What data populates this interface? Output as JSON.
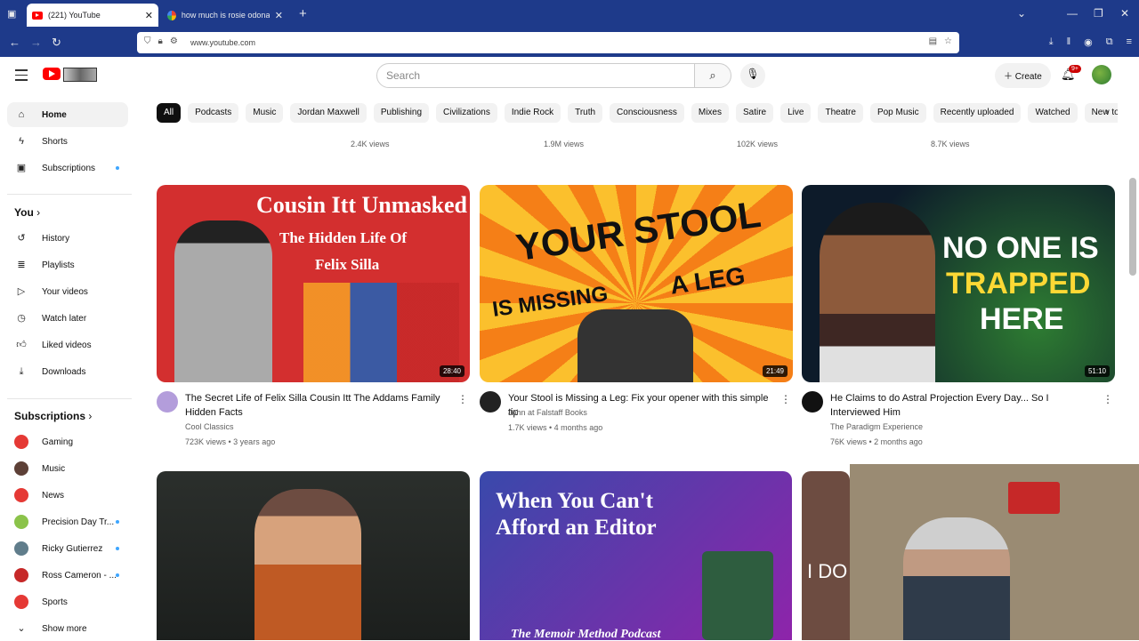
{
  "browser": {
    "tabs": [
      {
        "title": "(221) YouTube",
        "active": true
      },
      {
        "title": "how much is rosie odonald wor",
        "active": false
      }
    ],
    "url": "www.youtube.com"
  },
  "masthead": {
    "search_placeholder": "Search",
    "create_label": "Create",
    "notif_badge": "9+"
  },
  "chips": [
    "All",
    "Podcasts",
    "Music",
    "Jordan Maxwell",
    "Publishing",
    "Civilizations",
    "Indie Rock",
    "Truth",
    "Consciousness",
    "Mixes",
    "Satire",
    "Live",
    "Theatre",
    "Pop Music",
    "Recently uploaded",
    "Watched",
    "New to you"
  ],
  "sidebar": {
    "main": [
      {
        "label": "Home",
        "icon": "home-icon"
      },
      {
        "label": "Shorts",
        "icon": "shorts-icon"
      },
      {
        "label": "Subscriptions",
        "icon": "subscriptions-icon"
      }
    ],
    "you_header": "You",
    "you": [
      {
        "label": "History",
        "icon": "history-icon"
      },
      {
        "label": "Playlists",
        "icon": "playlists-icon"
      },
      {
        "label": "Your videos",
        "icon": "your-videos-icon"
      },
      {
        "label": "Watch later",
        "icon": "watch-later-icon"
      },
      {
        "label": "Liked videos",
        "icon": "liked-icon"
      },
      {
        "label": "Downloads",
        "icon": "downloads-icon"
      }
    ],
    "subs_header": "Subscriptions",
    "subs": [
      {
        "label": "Gaming",
        "color": "#e53935"
      },
      {
        "label": "Music",
        "color": "#5d4037"
      },
      {
        "label": "News",
        "color": "#e53935"
      },
      {
        "label": "Precision Day Tr...",
        "color": "#8bc34a"
      },
      {
        "label": "Ricky Gutierrez",
        "color": "#607d8b"
      },
      {
        "label": "Ross Cameron - ...",
        "color": "#c62828"
      },
      {
        "label": "Sports",
        "color": "#e53935"
      }
    ],
    "show_more": "Show more"
  },
  "prev_row_views": [
    "2.4K views",
    "1.9M views",
    "102K views",
    "8.7K views"
  ],
  "videos": [
    {
      "title": "The Secret Life of Felix Silla Cousin Itt The Addams Family Hidden Facts",
      "channel": "Cool Classics",
      "stats": "723K views • 3 years ago",
      "duration": "28:40",
      "thumb_lines": [
        "Cousin Itt Unmasked",
        "The Hidden Life Of",
        "Felix Silla"
      ]
    },
    {
      "title": "Your Stool is Missing a Leg: Fix your opener with this simple tip",
      "channel": "John at Falstaff Books",
      "stats": "1.7K views • 4 months ago",
      "duration": "21:49",
      "thumb_lines": [
        "YOUR STOOL",
        "IS MISSING",
        "A LEG"
      ]
    },
    {
      "title": "He Claims to do Astral Projection Every Day... So I Interviewed Him",
      "channel": "The Paradigm Experience",
      "stats": "76K views • 2 months ago",
      "duration": "51:10",
      "thumb_lines": [
        "NO ONE IS",
        "TRAPPED",
        "HERE"
      ]
    }
  ],
  "row2": {
    "thumb2_lines": [
      "When You Can't",
      "Afford an Editor",
      "The Memoir Method Podcast"
    ],
    "thumb3_text": "I DO"
  }
}
